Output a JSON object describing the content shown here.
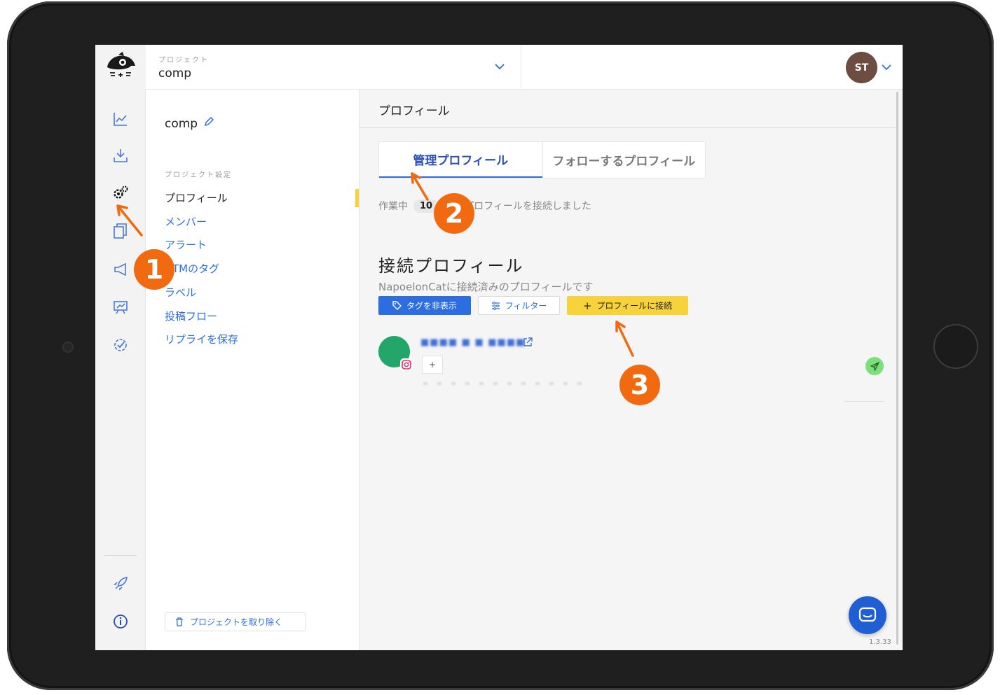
{
  "topbar": {
    "project_label": "プロジェクト",
    "project_value": "comp",
    "user_initials": "ST"
  },
  "rail": {
    "icons": [
      "chart-icon",
      "download-icon",
      "settings-icon",
      "copy-icon",
      "megaphone-icon",
      "presentation-icon",
      "verified-icon",
      "rocket-icon",
      "info-icon"
    ]
  },
  "menu": {
    "project_name": "comp",
    "section_label": "プロジェクト設定",
    "items": [
      {
        "label": "プロフィール"
      },
      {
        "label": "メンバー"
      },
      {
        "label": "アラート"
      },
      {
        "label": "UTMのタグ"
      },
      {
        "label": "ラベル"
      },
      {
        "label": "投稿フロー"
      },
      {
        "label": "リプライを保存"
      }
    ],
    "remove_label": "プロジェクトを取り除く"
  },
  "content": {
    "header": "プロフィール",
    "tabs": [
      {
        "label": "管理プロフィール"
      },
      {
        "label": "フォローするプロフィール"
      }
    ],
    "status_prefix": "作業中",
    "status_count": "10",
    "status_suffix": "個のプロフィールを接続しました",
    "section_title": "接続プロフィール",
    "section_subtitle": "NapoelonCatに接続済みのプロフィールです",
    "buttons": {
      "hide_tags": "タグを非表示",
      "filter": "フィルター",
      "connect": "プロフィールに接続"
    },
    "profile": {
      "name": "■■■■ ■ ■ ■■■■",
      "tag_add": "+"
    },
    "version": "1.3.33"
  },
  "annotations": [
    "1",
    "2",
    "3"
  ],
  "colors": {
    "accent_blue": "#2c6ee2",
    "accent_yellow": "#f7d23b",
    "annotation_orange": "#f26a0f",
    "avatar_brown": "#6d4c41"
  }
}
